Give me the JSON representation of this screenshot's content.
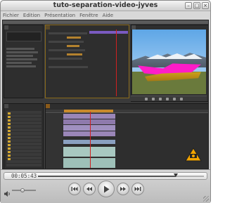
{
  "window": {
    "title": "tuto-separation-video-jyves"
  },
  "menubar": {
    "items": [
      "Fichier",
      "Edition",
      "Présentation",
      "Fenêtre",
      "Aide"
    ]
  },
  "player": {
    "timecode": "00:05:43",
    "progress_fraction": 0.83,
    "volume_fraction": 0.45
  },
  "icons": {
    "minimize": "minimize-icon",
    "maximize": "maximize-icon",
    "close": "close-icon",
    "rewind": "rewind-icon",
    "fast_rewind": "skip-back-icon",
    "play": "play-icon",
    "fast_forward": "skip-forward-icon",
    "end": "skip-end-icon",
    "volume": "speaker-icon"
  },
  "colors": {
    "magenta_mask": "#ff1cc8",
    "timeline_orange": "#c98a2c",
    "playhead_red": "#d02020"
  }
}
